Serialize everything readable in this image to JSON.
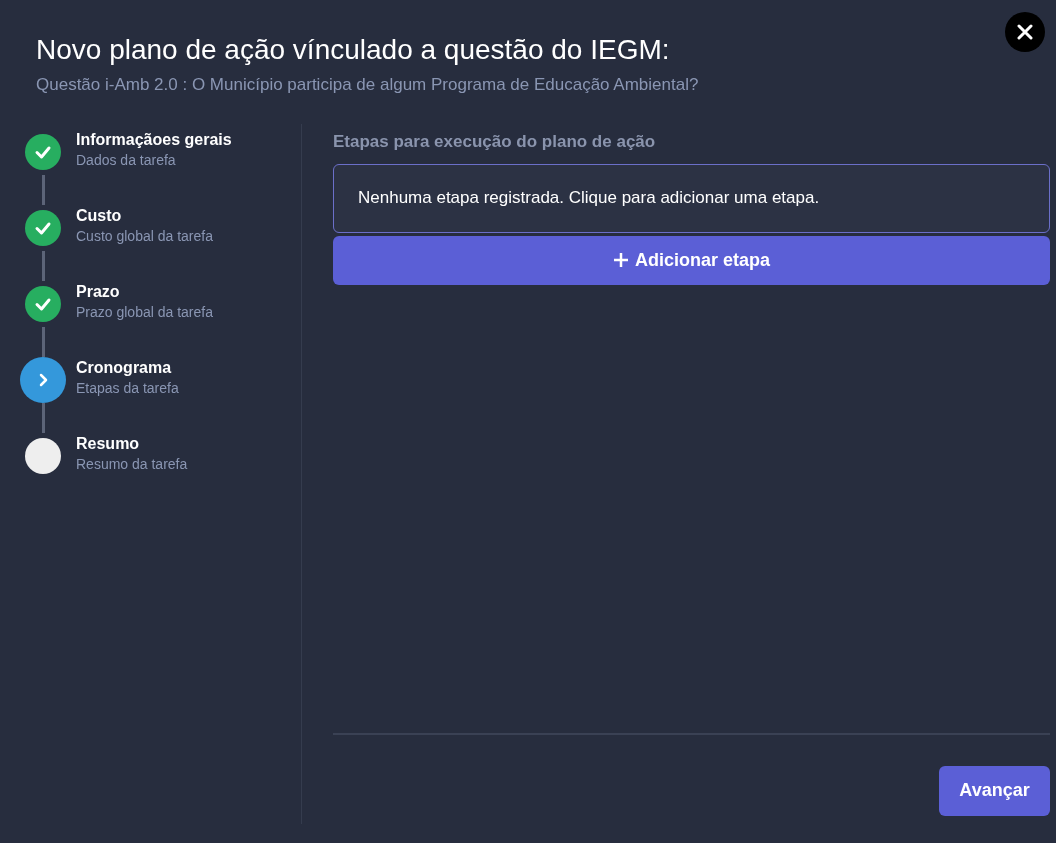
{
  "dialog": {
    "title": "Novo plano de ação vínculado a questão do IEGM:",
    "subtitle": "Questão i-Amb 2.0 : O Município participa de algum Programa de Educação Ambiental?"
  },
  "steps": [
    {
      "title": "Informaçãoes gerais",
      "description": "Dados da tarefa",
      "kind": "done"
    },
    {
      "title": "Custo",
      "description": "Custo global da tarefa",
      "kind": "done"
    },
    {
      "title": "Prazo",
      "description": "Prazo global da tarefa",
      "kind": "done"
    },
    {
      "title": "Cronograma",
      "description": "Etapas da tarefa",
      "kind": "current"
    },
    {
      "title": "Resumo",
      "description": "Resumo da tarefa",
      "kind": "pending"
    }
  ],
  "section": {
    "heading": "Etapas para execução do plano de ação",
    "empty_message": "Nenhuma etapa registrada. Clique para adicionar uma etapa.",
    "add_button": "Adicionar etapa"
  },
  "footer": {
    "next_button": "Avançar"
  }
}
